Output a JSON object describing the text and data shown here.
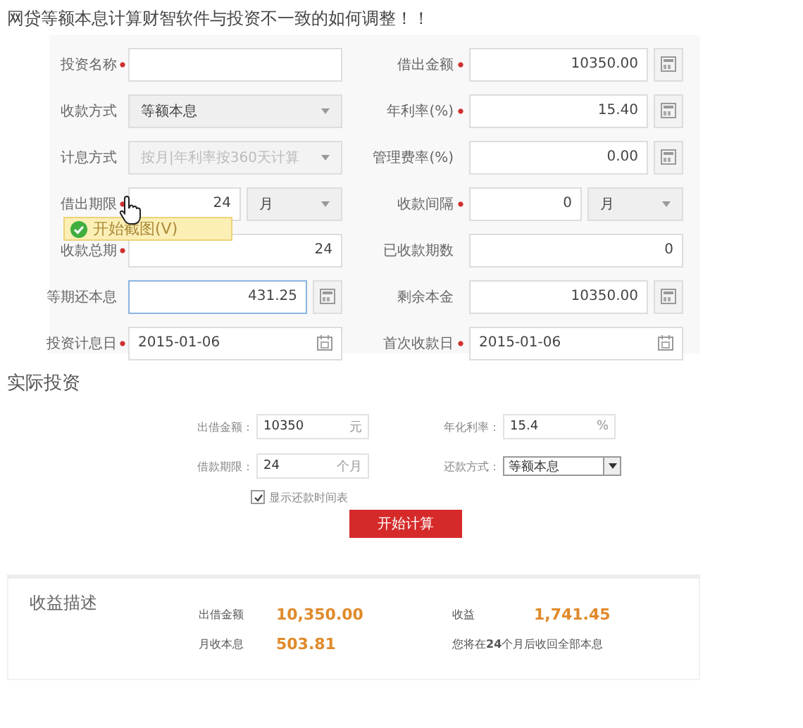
{
  "page_title": "网贷等额本息计算财智软件与投资不一致的如何调整！！",
  "loan_form": {
    "left_fields": [
      {
        "label": "投资名称",
        "kind": "text",
        "required": true,
        "focused": false,
        "disabled": false
      },
      {
        "label": "收款方式",
        "kind": "select",
        "required": false,
        "focused": false,
        "disabled": false,
        "value": "等额本息"
      },
      {
        "label": "计息方式",
        "kind": "select",
        "required": false,
        "focused": false,
        "disabled": true,
        "value": "按月|年利率按360天计算"
      },
      {
        "label": "借出期限",
        "kind": "split",
        "required": true,
        "focused": false,
        "disabled": false,
        "value": "24",
        "unit": "月"
      },
      {
        "label": "收款总期",
        "kind": "text",
        "required": true,
        "focused": false,
        "disabled": false,
        "value": "24"
      },
      {
        "label": "等期还本息",
        "kind": "calc",
        "required": false,
        "focused": true,
        "disabled": false,
        "value": "431.25"
      },
      {
        "label": "投资计息日",
        "kind": "date",
        "required": true,
        "focused": false,
        "disabled": false,
        "value": "2015-01-06"
      }
    ],
    "right_fields": [
      {
        "label": "借出金额",
        "kind": "calc",
        "required": true,
        "focused": false,
        "disabled": false,
        "value": "10350.00"
      },
      {
        "label": "年利率(%)",
        "kind": "calc",
        "required": true,
        "focused": false,
        "disabled": false,
        "value": "15.40"
      },
      {
        "label": "管理费率(%)",
        "kind": "calc",
        "required": false,
        "focused": false,
        "disabled": false,
        "value": "0.00"
      },
      {
        "label": "收款间隔",
        "kind": "split",
        "required": true,
        "focused": false,
        "disabled": false,
        "value": "0",
        "unit": "月"
      },
      {
        "label": "已收款期数",
        "kind": "text",
        "required": false,
        "focused": false,
        "disabled": false,
        "value": "0"
      },
      {
        "label": "剩余本金",
        "kind": "calc",
        "required": false,
        "focused": false,
        "disabled": false,
        "value": "10350.00"
      },
      {
        "label": "首次收款日",
        "kind": "date",
        "required": true,
        "focused": false,
        "disabled": false,
        "value": "2015-01-06"
      }
    ]
  },
  "tooltip": {
    "label": "开始截图(V)"
  },
  "actual_investment": {
    "title": "实际投资",
    "fields": [
      {
        "label": "出借金额：",
        "kind": "input",
        "value": "10350",
        "unit": "元"
      },
      {
        "label": "年化利率：",
        "kind": "input",
        "value": "15.4",
        "unit": "%"
      },
      {
        "label": "借款期限：",
        "kind": "input",
        "value": "24",
        "unit": "个月"
      },
      {
        "label": "还款方式：",
        "kind": "select",
        "value": "等额本息"
      }
    ],
    "checkbox": {
      "label": "显示还款时间表",
      "checked": true
    },
    "button": "开始计算"
  },
  "returns": {
    "title": "收益描述",
    "items": [
      {
        "label": "出借金额",
        "value": "10,350.00"
      },
      {
        "label": "收益",
        "value": "1,741.45"
      },
      {
        "label": "月收本息",
        "value": "503.81"
      }
    ],
    "note": "您将在**24**个月后收回全部本息"
  }
}
